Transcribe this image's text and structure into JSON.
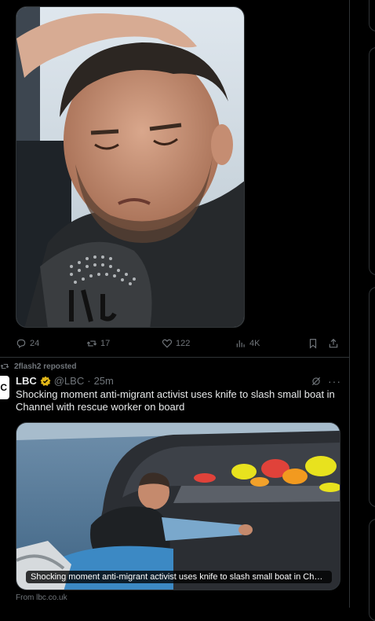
{
  "tweet1": {
    "actions": {
      "replies": "24",
      "reposts": "17",
      "likes": "122",
      "views": "4K"
    }
  },
  "tweet2": {
    "repost_label": "2flash2 reposted",
    "avatar_text": "C",
    "author_name": "LBC",
    "author_handle": "@LBC",
    "separator": "·",
    "time": "25m",
    "text": "Shocking moment anti-migrant activist uses knife to slash small boat in Channel with rescue worker on board",
    "card": {
      "caption": "Shocking moment anti-migrant activist uses knife to slash small boat in Chan…",
      "source": "From lbc.co.uk"
    }
  },
  "colors": {
    "background": "#000000",
    "text": "#e7e9ea",
    "muted": "#71767b",
    "border": "#2f3336",
    "verified_gold": "#e2b719"
  },
  "icons": [
    "reply-icon",
    "repost-icon",
    "like-icon",
    "views-icon",
    "bookmark-icon",
    "share-icon",
    "verified-badge-icon",
    "grok-icon",
    "more-icon"
  ]
}
